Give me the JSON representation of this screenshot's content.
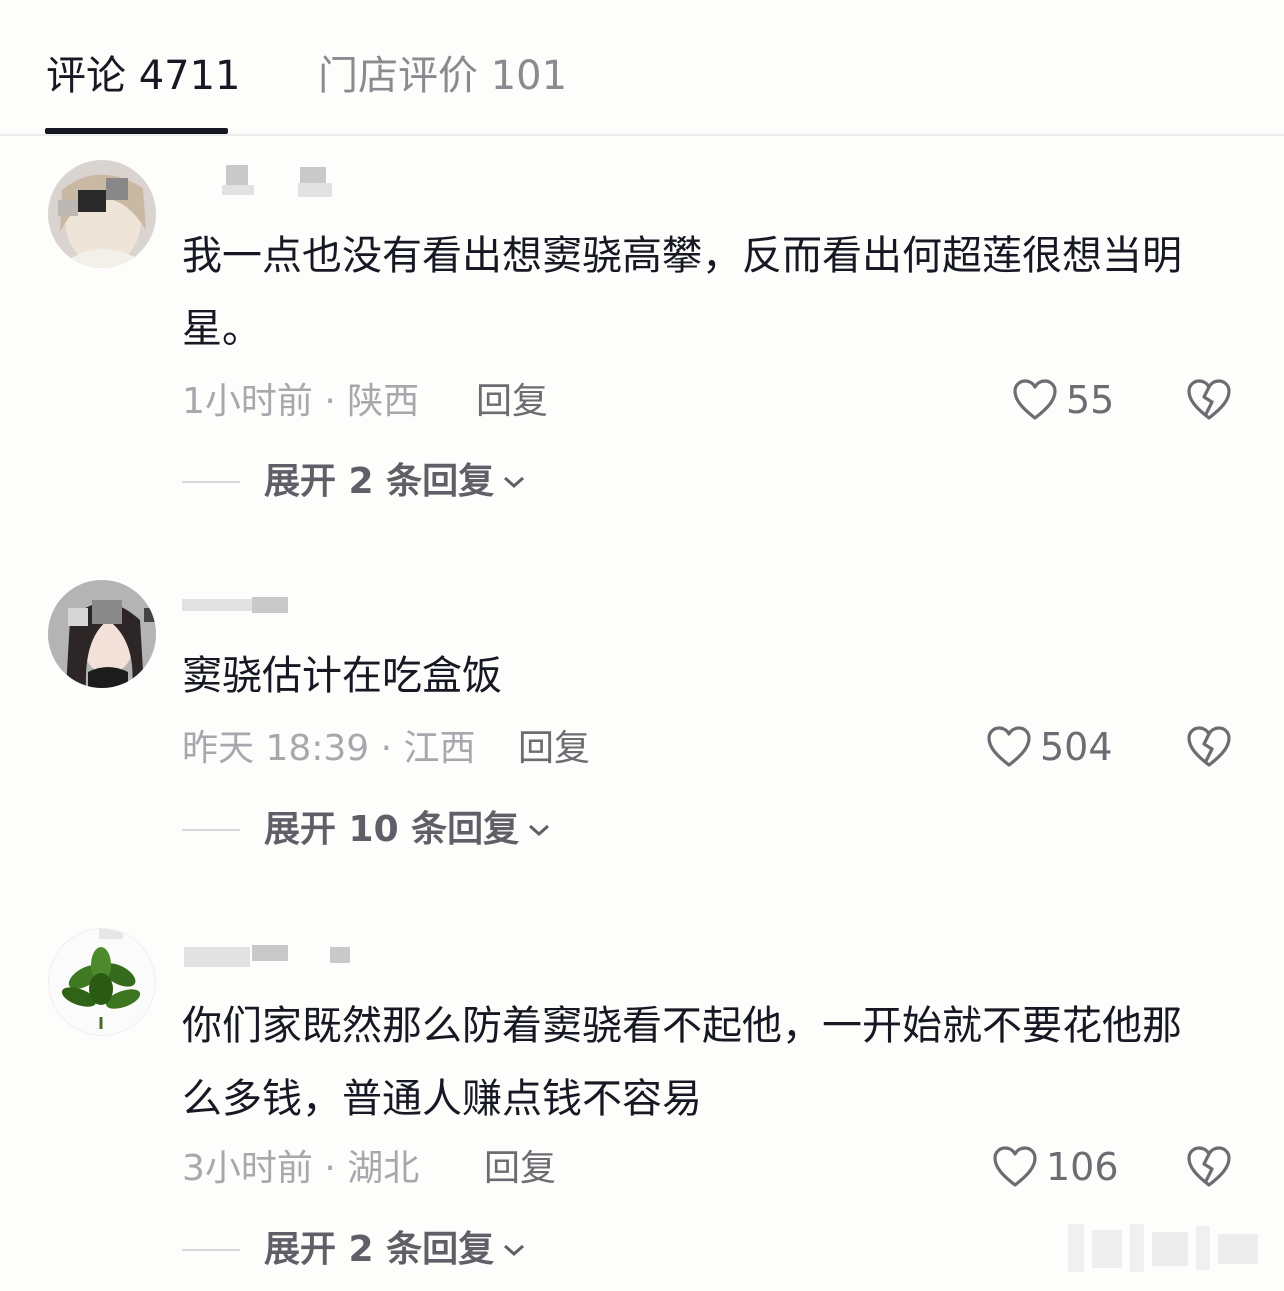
{
  "tabs": [
    {
      "label": "评论 4711",
      "active": true
    },
    {
      "label": "门店评价 101",
      "active": false
    }
  ],
  "comments": [
    {
      "text": "我一点也没有看出想窦骁高攀，反而看出何超莲很想当明星。",
      "time_location": "1小时前 · 陕西",
      "reply_label": "回复",
      "likes": "55",
      "expand_label": "展开 2 条回复"
    },
    {
      "text": "窦骁估计在吃盒饭",
      "time_location": "昨天 18:39 · 江西",
      "reply_label": "回复",
      "likes": "504",
      "expand_label": "展开 10 条回复"
    },
    {
      "text": "你们家既然那么防着窦骁看不起他，一开始就不要花他那么多钱，普通人赚点钱不容易",
      "time_location": "3小时前 · 湖北",
      "reply_label": "回复",
      "likes": "106",
      "expand_label": "展开 2 条回复"
    }
  ],
  "icons": {
    "like": "heart-outline-icon",
    "dislike": "broken-heart-icon",
    "expand": "chevron-down-icon"
  },
  "colors": {
    "text_primary": "#161823",
    "text_secondary": "#a7a8ad",
    "text_action": "#6c6d73",
    "background": "#fdfdfb"
  }
}
